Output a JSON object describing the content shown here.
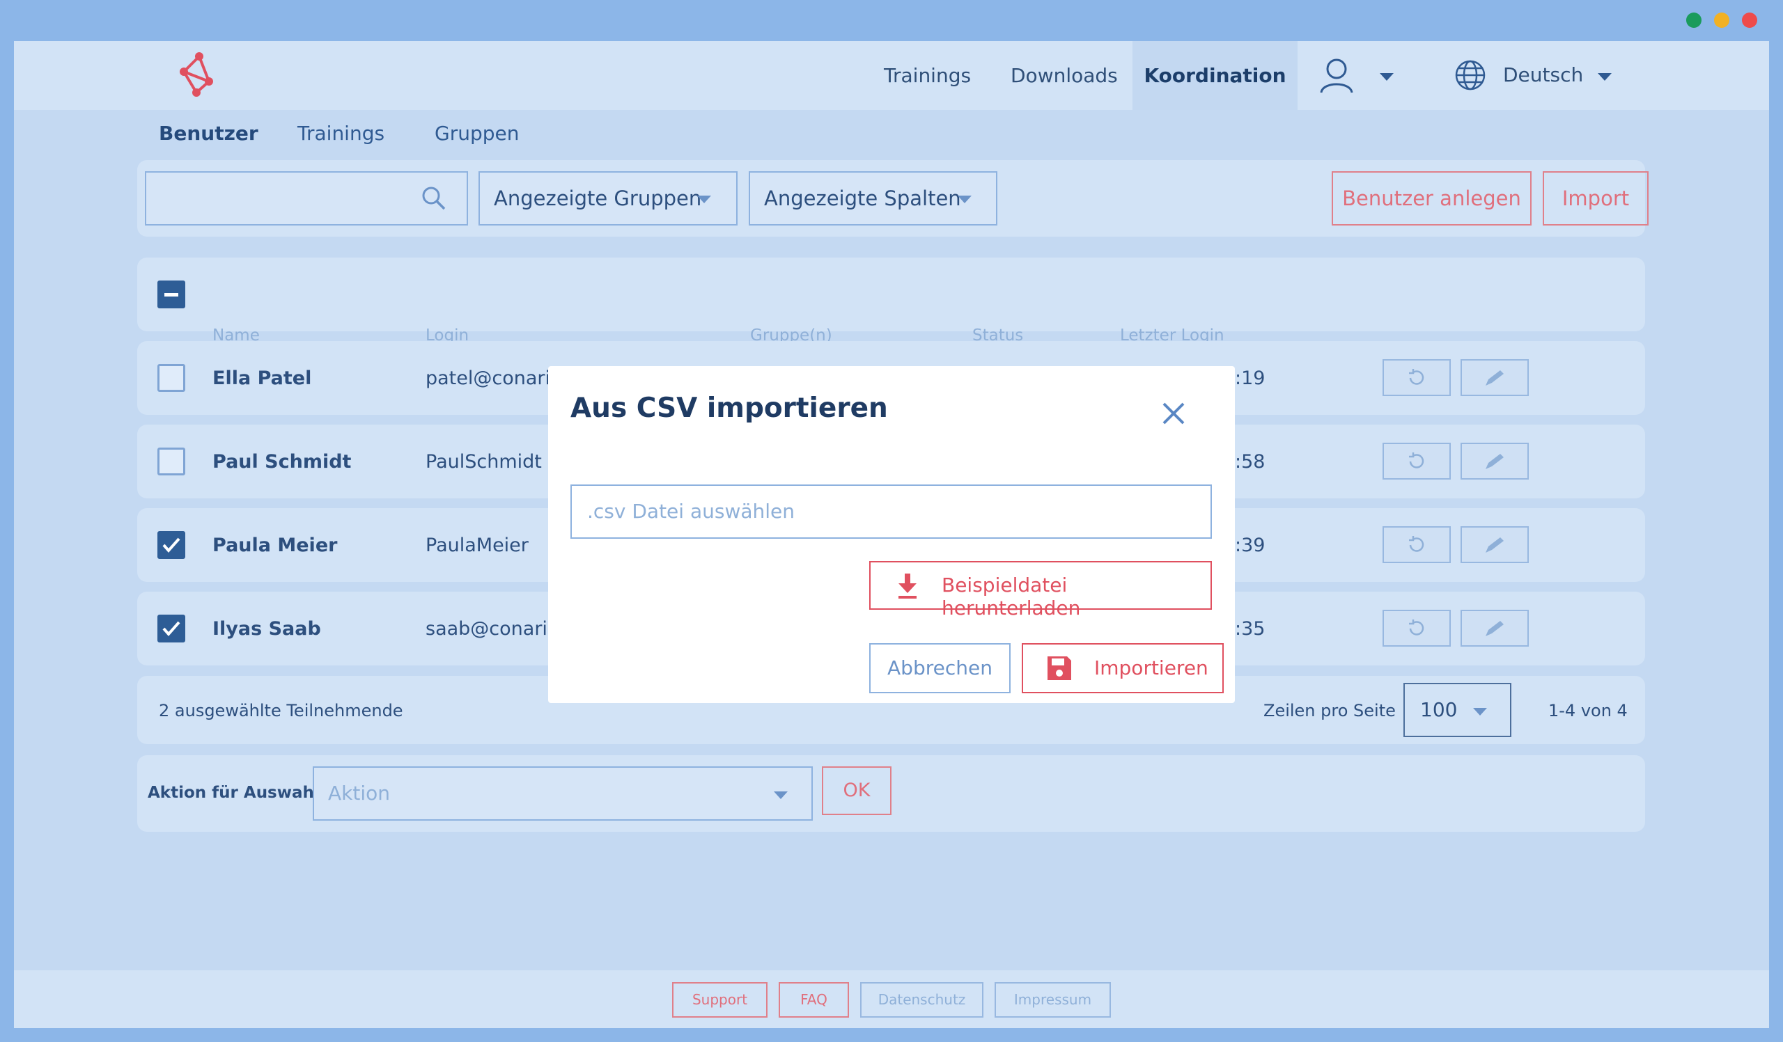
{
  "window_controls": {
    "colors": {
      "green": "#1a9b5c",
      "yellow": "#f2b124",
      "red": "#ee4b4b"
    }
  },
  "logo": {
    "icon": "molecule-logo-icon"
  },
  "nav": {
    "items": [
      {
        "label": "Trainings"
      },
      {
        "label": "Downloads"
      },
      {
        "label": "Koordination",
        "active": true
      }
    ],
    "user_icon": "user-icon",
    "language": {
      "icon": "globe-icon",
      "label": "Deutsch"
    }
  },
  "subtabs": [
    {
      "label": "Benutzer",
      "active": true
    },
    {
      "label": "Trainings"
    },
    {
      "label": "Gruppen"
    }
  ],
  "toolbar": {
    "search": {
      "value": "",
      "placeholder": "",
      "icon": "search-icon"
    },
    "groups_dropdown": "Angezeigte Gruppen",
    "columns_dropdown": "Angezeigte Spalten",
    "create_user": "Benutzer anlegen",
    "import": "Import"
  },
  "table": {
    "header_checkbox_state": "indeterminate",
    "columns": [
      "Name",
      "Login",
      "Gruppe(n)",
      "Status",
      "Letzter Login"
    ],
    "rows": [
      {
        "checked": false,
        "name": "Ella Patel",
        "login": "patel@conarion",
        "last_login": ":19"
      },
      {
        "checked": false,
        "name": "Paul Schmidt",
        "login": "PaulSchmidt",
        "last_login": ":58"
      },
      {
        "checked": true,
        "name": "Paula Meier",
        "login": "PaulaMeier",
        "last_login": ":39"
      },
      {
        "checked": true,
        "name": "Ilyas Saab",
        "login": "saab@conarion",
        "last_login": ":35"
      }
    ],
    "row_action_icons": [
      "reset-icon",
      "pencil-icon"
    ]
  },
  "pagination": {
    "selected_count": "2 ausgewählte Teilnehmende",
    "rows_per_page_label": "Zeilen pro Seite",
    "rows_per_page_value": "100",
    "range": "1-4 von 4"
  },
  "bulk_action": {
    "label": "Aktion für Auswahl:",
    "placeholder": "Aktion",
    "ok": "OK"
  },
  "footer": {
    "links": [
      "Support",
      "FAQ",
      "Datenschutz",
      "Impressum"
    ]
  },
  "modal": {
    "title": "Aus CSV importieren",
    "close_icon": "close-icon",
    "file_placeholder": ".csv Datei auswählen",
    "download_sample": "Beispieldatei herunterladen",
    "download_icon": "download-icon",
    "cancel": "Abbrechen",
    "import": "Importieren",
    "import_icon": "save-icon"
  },
  "colors": {
    "brand_red": "#e0505f",
    "primary_blue": "#2e5d96",
    "overlay_bg": "#c4d9f2"
  }
}
